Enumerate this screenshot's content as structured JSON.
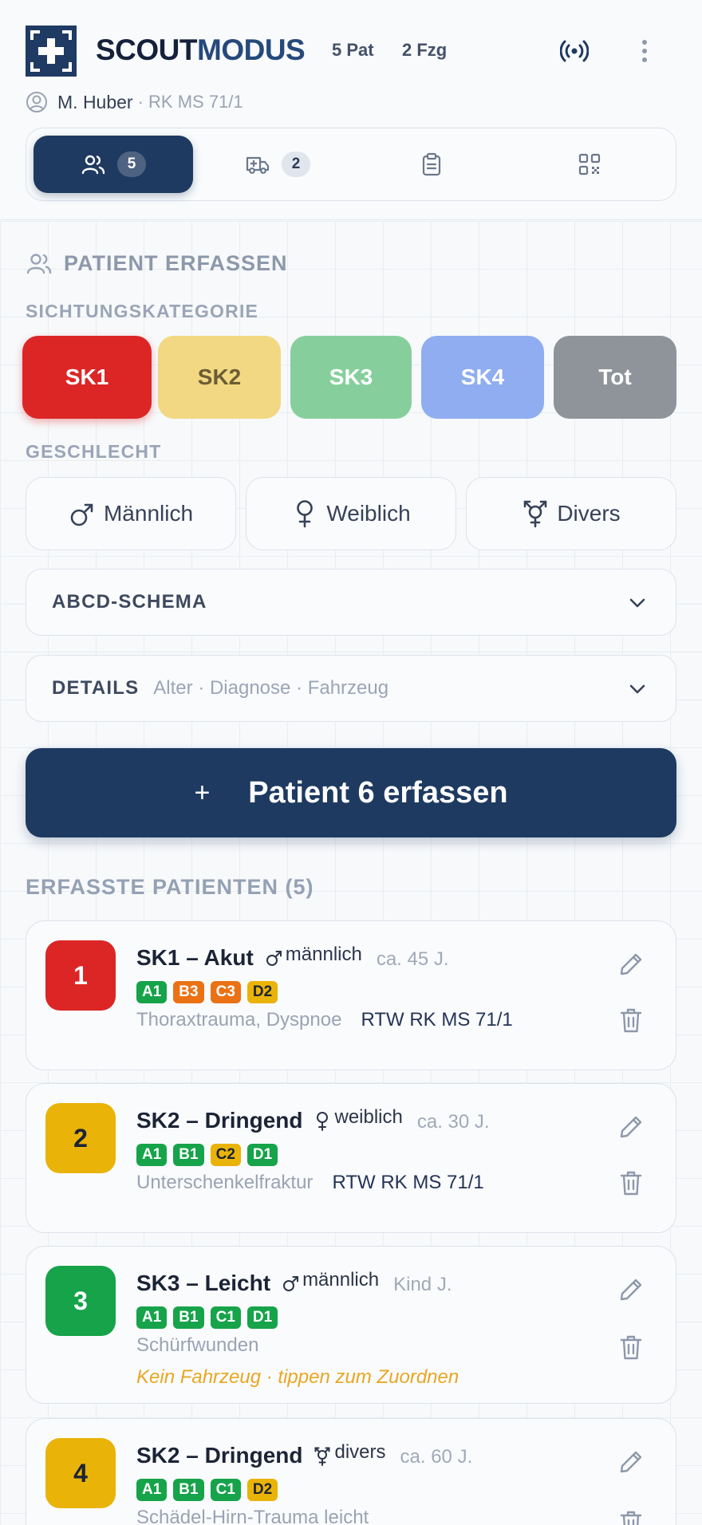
{
  "header": {
    "brand_a": "SCOUT",
    "brand_b": "MODUS",
    "patients_stat": "5 Pat",
    "vehicles_stat": "2 Fzg",
    "user_name": "M. Huber",
    "user_unit": "· RK MS 71/1",
    "tabs": [
      {
        "icon": "users-icon",
        "badge": "5",
        "active": true
      },
      {
        "icon": "ambulance-icon",
        "badge": "2",
        "active": false
      },
      {
        "icon": "clipboard-icon",
        "active": false
      },
      {
        "icon": "qr-code-icon",
        "active": false
      }
    ]
  },
  "form": {
    "title": "PATIENT ERFASSEN",
    "category_label": "SICHTUNGSKATEGORIE",
    "categories": [
      {
        "label": "SK1",
        "bg": "#dc2626",
        "fg": "#ffffff",
        "selected": true
      },
      {
        "label": "SK2",
        "bg": "#f2d882",
        "fg": "#6b5d35"
      },
      {
        "label": "SK3",
        "bg": "#86cf9c",
        "fg": "#ffffff"
      },
      {
        "label": "SK4",
        "bg": "#8fadf0",
        "fg": "#ffffff"
      },
      {
        "label": "Tot",
        "bg": "#8f949b",
        "fg": "#ffffff"
      }
    ],
    "sex_label": "GESCHLECHT",
    "sexes": [
      {
        "label": "Männlich",
        "icon": "male-icon"
      },
      {
        "label": "Weiblich",
        "icon": "female-icon"
      },
      {
        "label": "Divers",
        "icon": "diverse-icon"
      }
    ],
    "abcd_title": "ABCD-SCHEMA",
    "details_title": "DETAILS",
    "details_sub": "Alter · Diagnose · Fahrzeug",
    "submit_label": "Patient 6 erfassen",
    "submit_icon": "plus-icon"
  },
  "list": {
    "title": "ERFASSTE PATIENTEN (5)",
    "patients": [
      {
        "num": "1",
        "num_bg": "#dc2626",
        "num_fg": "#ffffff",
        "sk": "SK1 – Akut",
        "sex": "männlich",
        "sex_icon": "male-icon",
        "age": "ca. 45 J.",
        "tags": [
          {
            "t": "A1",
            "c": "#16a34a"
          },
          {
            "t": "B3",
            "c": "#ea7215"
          },
          {
            "t": "C3",
            "c": "#ea7215"
          },
          {
            "t": "D2",
            "c": "#eab308",
            "dark": true
          }
        ],
        "diag": "Thoraxtrauma, Dyspnoe",
        "vehicle": "RTW RK MS 71/1"
      },
      {
        "num": "2",
        "num_bg": "#eab308",
        "num_fg": "#1b2436",
        "sk": "SK2 – Dringend",
        "sex": "weiblich",
        "sex_icon": "female-icon",
        "age": "ca. 30 J.",
        "tags": [
          {
            "t": "A1",
            "c": "#16a34a"
          },
          {
            "t": "B1",
            "c": "#16a34a"
          },
          {
            "t": "C2",
            "c": "#eab308",
            "dark": true
          },
          {
            "t": "D1",
            "c": "#16a34a"
          }
        ],
        "diag": "Unterschenkelfraktur",
        "vehicle": "RTW RK MS 71/1"
      },
      {
        "num": "3",
        "num_bg": "#16a34a",
        "num_fg": "#ffffff",
        "sk": "SK3 – Leicht",
        "sex": "männlich",
        "sex_icon": "male-icon",
        "age": "Kind J.",
        "tags": [
          {
            "t": "A1",
            "c": "#16a34a"
          },
          {
            "t": "B1",
            "c": "#16a34a"
          },
          {
            "t": "C1",
            "c": "#16a34a"
          },
          {
            "t": "D1",
            "c": "#16a34a"
          }
        ],
        "diag": "Schürfwunden",
        "vehicle": "",
        "warning": "Kein Fahrzeug · tippen zum Zuordnen"
      },
      {
        "num": "4",
        "num_bg": "#eab308",
        "num_fg": "#1b2436",
        "sk": "SK2 – Dringend",
        "sex": "divers",
        "sex_icon": "diverse-icon",
        "age": "ca. 60 J.",
        "tags": [
          {
            "t": "A1",
            "c": "#16a34a"
          },
          {
            "t": "B1",
            "c": "#16a34a"
          },
          {
            "t": "C1",
            "c": "#16a34a"
          },
          {
            "t": "D2",
            "c": "#eab308",
            "dark": true
          }
        ],
        "diag": "Schädel-Hirn-Trauma leicht",
        "vehicle": ""
      }
    ]
  }
}
